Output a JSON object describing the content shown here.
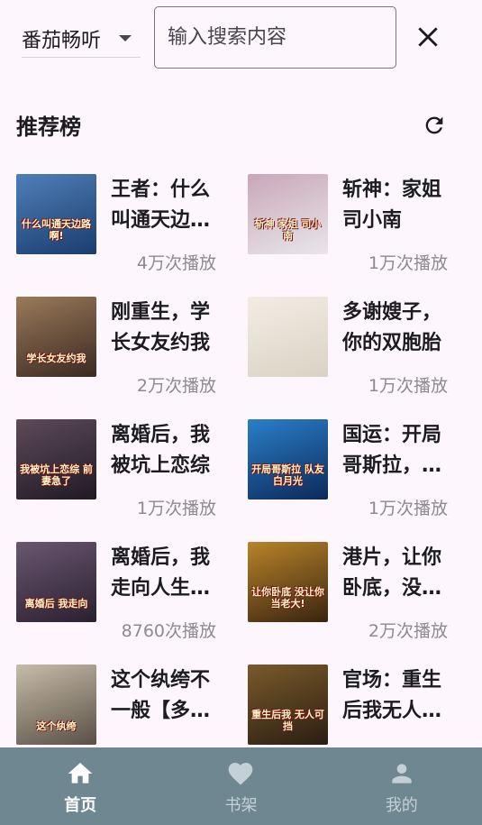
{
  "header": {
    "source_label": "番茄畅听",
    "search_placeholder": "输入搜索内容"
  },
  "section": {
    "title": "推荐榜"
  },
  "books": [
    {
      "title": "王者：什么叫通天边路啊",
      "plays": "4万次播放",
      "cover_text": "什么叫通天边路啊!",
      "cover_colors": [
        "#1a3d6e",
        "#4f7fb8"
      ]
    },
    {
      "title": "斩神：家姐司小南",
      "plays": "1万次播放",
      "cover_text": "斩神 家姐 司小南",
      "cover_colors": [
        "#e8e6ea",
        "#c9a7b8"
      ]
    },
    {
      "title": "刚重生，学长女友约我",
      "plays": "2万次播放",
      "cover_text": "学长女友约我",
      "cover_colors": [
        "#3b2a22",
        "#9a7a5a"
      ]
    },
    {
      "title": "多谢嫂子，你的双胞胎",
      "plays": "1万次播放",
      "cover_text": "",
      "cover_colors": [
        "#d9d2c4",
        "#f2ede4"
      ]
    },
    {
      "title": "离婚后，我被坑上恋综",
      "plays": "1万次播放",
      "cover_text": "我被坑上恋综 前妻急了",
      "cover_colors": [
        "#1f1a24",
        "#5e4a5a"
      ]
    },
    {
      "title": "国运：开局哥斯拉，队友",
      "plays": "1万次播放",
      "cover_text": "开局哥斯拉 队友白月光",
      "cover_colors": [
        "#0c2a5a",
        "#2a7fc9"
      ]
    },
    {
      "title": "离婚后，我走向人生巅峰",
      "plays": "8760次播放",
      "cover_text": "离婚后 我走向",
      "cover_colors": [
        "#2a2030",
        "#6a5670"
      ]
    },
    {
      "title": "港片，让你卧底，没让你当老大",
      "plays": "2万次播放",
      "cover_text": "让你卧底 没让你当老大!",
      "cover_colors": [
        "#3a2410",
        "#b8842a"
      ]
    },
    {
      "title": "这个纨绔不一般【多女主】",
      "plays": "",
      "cover_text": "这个纨绔",
      "cover_colors": [
        "#5a5046",
        "#c7bca8"
      ]
    },
    {
      "title": "官场：重生后我无人可挡",
      "plays": "",
      "cover_text": "重生后我 无人可挡",
      "cover_colors": [
        "#2a1e12",
        "#7a5a2a"
      ]
    }
  ],
  "nav": [
    {
      "label": "首页",
      "icon": "home-icon",
      "active": true
    },
    {
      "label": "书架",
      "icon": "heart-icon",
      "active": false
    },
    {
      "label": "我的",
      "icon": "person-icon",
      "active": false
    }
  ],
  "colors": {
    "background": "#fdf6fd",
    "nav_background": "#6e8791",
    "muted_text": "#8d8a90"
  }
}
